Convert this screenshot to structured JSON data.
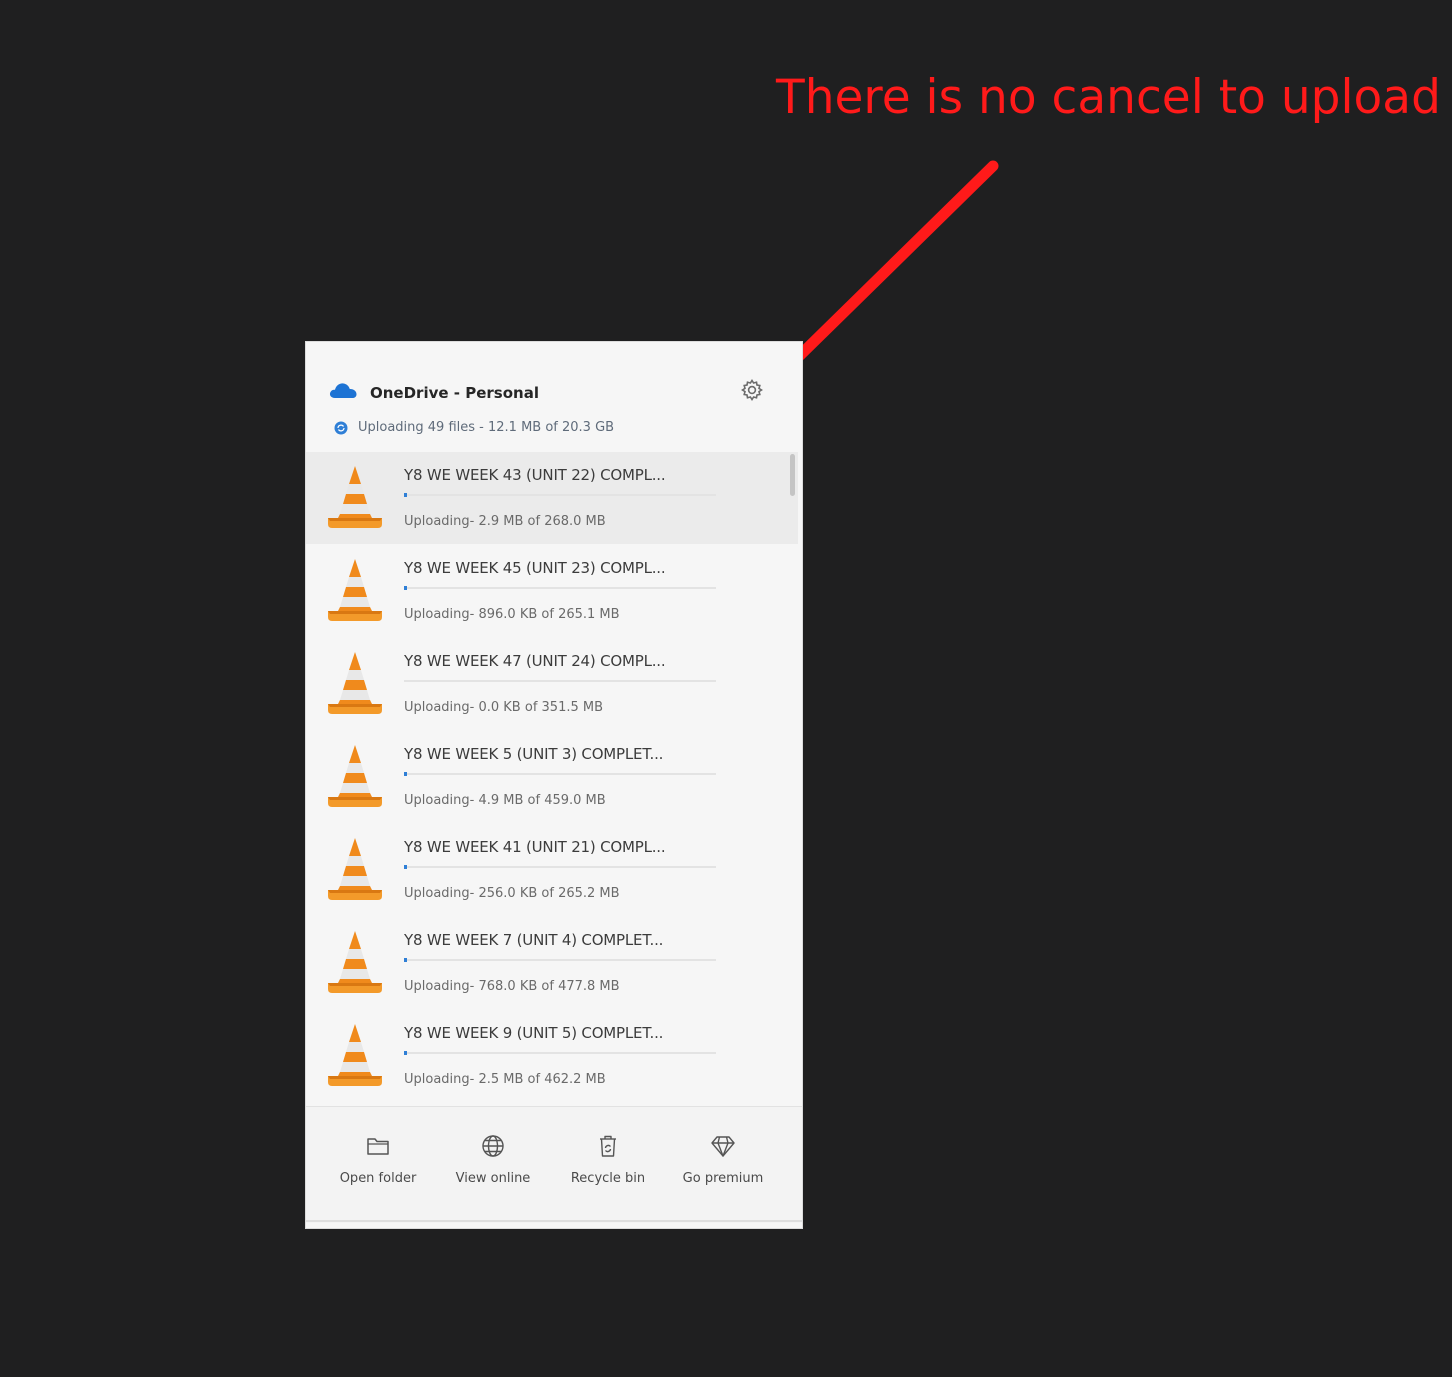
{
  "annotation": {
    "text": "There is no cancel to upload",
    "color": "#ff1a1a"
  },
  "panel": {
    "account_name": "OneDrive - Personal",
    "sync_status": "Uploading 49 files - 12.1 MB of 20.3 GB",
    "icons": {
      "account": "cloud-icon",
      "settings": "gear-icon",
      "sync": "sync-icon",
      "file": "vlc-cone-icon"
    },
    "accent_color": "#2f7fd6",
    "files": [
      {
        "name": "Y8 WE WEEK 43 (UNIT 22) COMPL...",
        "status": "Uploading- 2.9 MB of 268.0 MB",
        "progress": 0.011,
        "selected": true
      },
      {
        "name": "Y8 WE WEEK 45 (UNIT 23) COMPL...",
        "status": "Uploading- 896.0 KB of 265.1 MB",
        "progress": 0.003,
        "selected": false
      },
      {
        "name": "Y8 WE WEEK 47 (UNIT 24) COMPL...",
        "status": "Uploading- 0.0 KB of 351.5 MB",
        "progress": 0.0,
        "selected": false
      },
      {
        "name": "Y8 WE WEEK 5 (UNIT 3) COMPLET...",
        "status": "Uploading- 4.9 MB of 459.0 MB",
        "progress": 0.011,
        "selected": false
      },
      {
        "name": "Y8 WE WEEK 41 (UNIT 21) COMPL...",
        "status": "Uploading- 256.0 KB of 265.2 MB",
        "progress": 0.001,
        "selected": false
      },
      {
        "name": "Y8 WE WEEK 7 (UNIT 4) COMPLET...",
        "status": "Uploading- 768.0 KB of 477.8 MB",
        "progress": 0.002,
        "selected": false
      },
      {
        "name": "Y8 WE WEEK 9 (UNIT 5) COMPLET...",
        "status": "Uploading- 2.5 MB of 462.2 MB",
        "progress": 0.005,
        "selected": false
      }
    ],
    "footer": [
      {
        "label": "Open folder",
        "icon": "folder-icon"
      },
      {
        "label": "View online",
        "icon": "globe-icon"
      },
      {
        "label": "Recycle bin",
        "icon": "recycle-bin-icon"
      },
      {
        "label": "Go premium",
        "icon": "diamond-icon"
      }
    ]
  }
}
